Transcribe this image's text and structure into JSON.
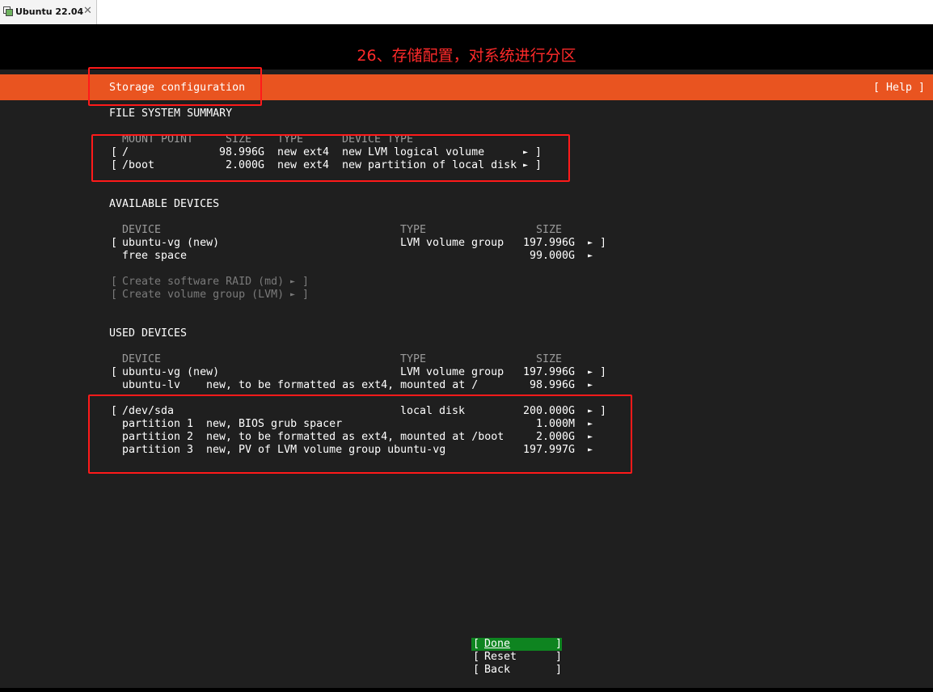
{
  "window": {
    "tab_title": "Ubuntu 22.04",
    "close_glyph": "✕"
  },
  "annotation": {
    "text": "26、存储配置，对系统进行分区",
    "color": "#ff2a2a"
  },
  "header": {
    "title": "Storage configuration",
    "help": "[ Help ]",
    "color": "#e95420"
  },
  "file_system_summary": {
    "heading": "FILE SYSTEM SUMMARY",
    "columns": [
      "MOUNT POINT",
      "SIZE",
      "TYPE",
      "DEVICE TYPE"
    ],
    "rows": [
      {
        "mount": "/",
        "size": "98.996G",
        "type": "new ext4",
        "device_type": "new LVM logical volume"
      },
      {
        "mount": "/boot",
        "size": "2.000G",
        "type": "new ext4",
        "device_type": "new partition of local disk"
      }
    ]
  },
  "available_devices": {
    "heading": "AVAILABLE DEVICES",
    "columns": [
      "DEVICE",
      "TYPE",
      "SIZE"
    ],
    "rows": [
      {
        "device": "ubuntu-vg (new)",
        "type": "LVM volume group",
        "size": "197.996G"
      },
      {
        "device": "free space",
        "type": "",
        "size": "99.000G"
      }
    ],
    "actions": [
      "Create software RAID (md)",
      "Create volume group (LVM)"
    ]
  },
  "used_devices": {
    "heading": "USED DEVICES",
    "columns": [
      "DEVICE",
      "TYPE",
      "SIZE"
    ],
    "vg": [
      {
        "device": "ubuntu-vg (new)",
        "type": "LVM volume group",
        "size": "197.996G"
      },
      {
        "device": "ubuntu-lv",
        "desc": "new, to be formatted as ext4, mounted at /",
        "size": "98.996G"
      }
    ],
    "disk": [
      {
        "device": "/dev/sda",
        "type": "local disk",
        "size": "200.000G"
      },
      {
        "device": "partition 1",
        "desc": "new, BIOS grub spacer",
        "size": "1.000M"
      },
      {
        "device": "partition 2",
        "desc": "new, to be formatted as ext4, mounted at /boot",
        "size": "2.000G"
      },
      {
        "device": "partition 3",
        "desc": "new, PV of LVM volume group ubuntu-vg",
        "size": "197.997G"
      }
    ]
  },
  "buttons": {
    "done": "Done",
    "reset": "Reset",
    "back": "Back",
    "done_color": "#0e8420"
  },
  "glyphs": {
    "arrow": "►",
    "open": "[",
    "close": "]"
  }
}
